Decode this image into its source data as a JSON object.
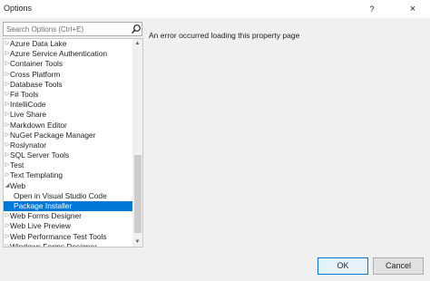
{
  "window": {
    "title": "Options",
    "help": "?",
    "close": "×"
  },
  "search": {
    "placeholder": "Search Options (Ctrl+E)",
    "value": ""
  },
  "tree": {
    "items": [
      {
        "label": "Azure Data Lake",
        "arrow": "▷",
        "level": 0
      },
      {
        "label": "Azure Service Authentication",
        "arrow": "▷",
        "level": 0
      },
      {
        "label": "Container Tools",
        "arrow": "▷",
        "level": 0
      },
      {
        "label": "Cross Platform",
        "arrow": "▷",
        "level": 0
      },
      {
        "label": "Database Tools",
        "arrow": "▷",
        "level": 0
      },
      {
        "label": "F# Tools",
        "arrow": "▷",
        "level": 0
      },
      {
        "label": "IntelliCode",
        "arrow": "▷",
        "level": 0
      },
      {
        "label": "Live Share",
        "arrow": "▷",
        "level": 0
      },
      {
        "label": "Markdown Editor",
        "arrow": "▷",
        "level": 0
      },
      {
        "label": "NuGet Package Manager",
        "arrow": "▷",
        "level": 0
      },
      {
        "label": "Roslynator",
        "arrow": "▷",
        "level": 0
      },
      {
        "label": "SQL Server Tools",
        "arrow": "▷",
        "level": 0
      },
      {
        "label": "Test",
        "arrow": "▷",
        "level": 0
      },
      {
        "label": "Text Templating",
        "arrow": "▷",
        "level": 0
      },
      {
        "label": "Web",
        "arrow": "◢",
        "level": 0
      },
      {
        "label": "Open in Visual Studio Code",
        "arrow": "",
        "level": 1
      },
      {
        "label": "Package Installer",
        "arrow": "",
        "level": 1,
        "selected": true
      },
      {
        "label": "Web Forms Designer",
        "arrow": "▷",
        "level": 0
      },
      {
        "label": "Web Live Preview",
        "arrow": "▷",
        "level": 0
      },
      {
        "label": "Web Performance Test Tools",
        "arrow": "▷",
        "level": 0
      },
      {
        "label": "Windows Forms Designer",
        "arrow": "▷",
        "level": 0,
        "cut": true
      }
    ]
  },
  "content": {
    "error": "An error occurred loading this property page"
  },
  "buttons": {
    "ok": "OK",
    "cancel": "Cancel"
  },
  "scrollbar": {
    "up": "▲",
    "down": "▼"
  },
  "colors": {
    "selection": "#0078d7",
    "background": "#f0f0f0"
  },
  "icons": {
    "search": "search-icon"
  }
}
